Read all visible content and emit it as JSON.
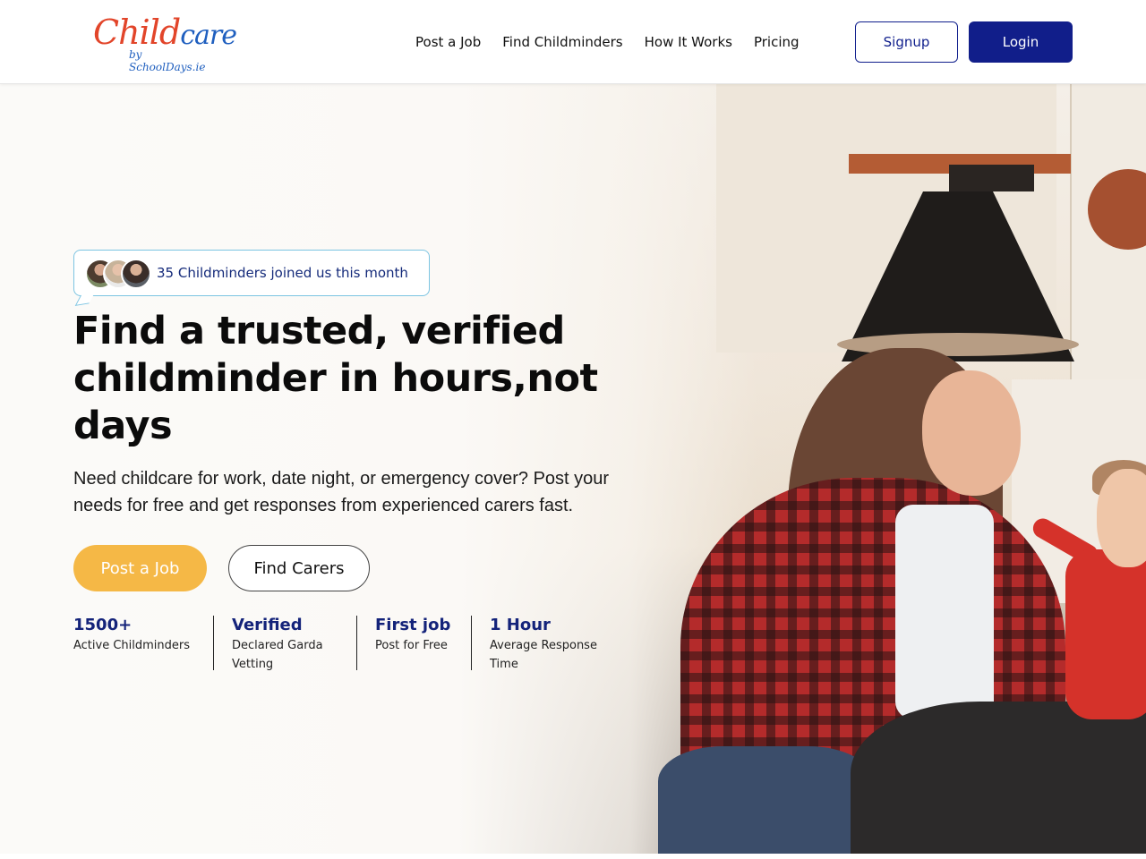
{
  "brand": {
    "logo_main_1": "Child",
    "logo_main_2": "care",
    "logo_sub": "by SchoolDays.ie"
  },
  "nav": {
    "items": [
      {
        "label": "Post a Job"
      },
      {
        "label": "Find Childminders"
      },
      {
        "label": "How It Works"
      },
      {
        "label": "Pricing"
      }
    ],
    "signup_label": "Signup",
    "login_label": "Login"
  },
  "hero": {
    "badge_text": "35 Childminders joined us this month",
    "headline": "Find a trusted, verified childminder in hours,not days",
    "subtext": "Need childcare for work, date night, or emergency cover? Post your needs for free and get responses from experienced carers fast.",
    "primary_cta": "Post a Job",
    "secondary_cta": "Find Carers",
    "stats": [
      {
        "value": "1500+",
        "label": "Active Childminders"
      },
      {
        "value": "Verified",
        "label": "Declared Garda Vetting"
      },
      {
        "value": "First job",
        "label": "Post for Free"
      },
      {
        "value": "1 Hour",
        "label": "Average Response Time"
      }
    ]
  },
  "colors": {
    "navy": "#111e8a",
    "accent_yellow": "#f5b846",
    "badge_border": "#7cc4e2",
    "logo_red": "#e2452a",
    "logo_blue": "#1f5fbf"
  }
}
